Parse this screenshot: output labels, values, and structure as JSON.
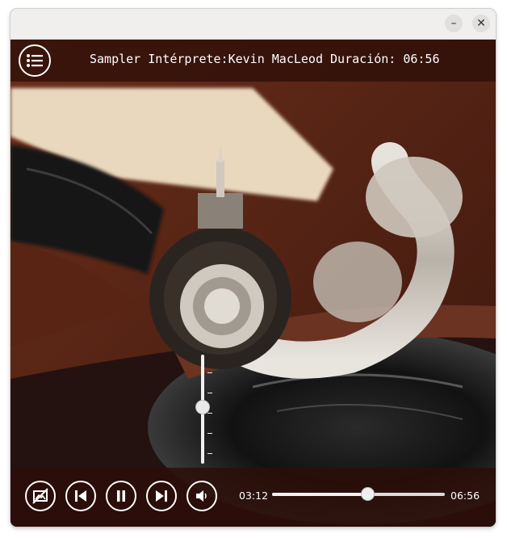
{
  "window": {
    "minimize_glyph": "–",
    "close_glyph": "✕"
  },
  "topbar": {
    "info_text": "Sampler Intérprete:Kevin MacLeod Duración: 06:56",
    "playlist_icon": "list-icon"
  },
  "volume": {
    "level": 0.6
  },
  "controls": {
    "elapsed": "03:12",
    "duration": "06:56",
    "progress": 0.55,
    "buttons": [
      "no-image-icon",
      "previous-icon",
      "pause-icon",
      "next-icon",
      "volume-icon"
    ]
  },
  "colors": {
    "overlay": "#2d0e08",
    "accent": "#ffffff"
  }
}
